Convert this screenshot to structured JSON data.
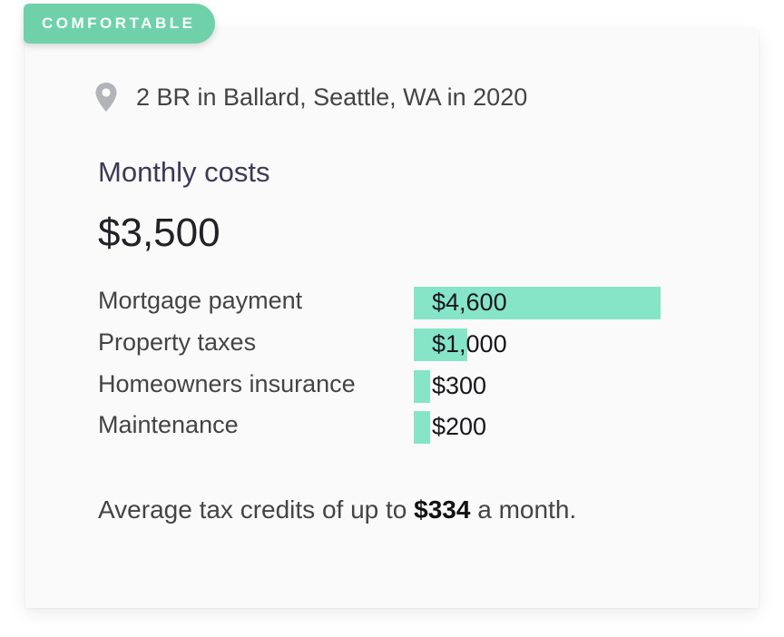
{
  "badge": {
    "label": "COMFORTABLE"
  },
  "location": {
    "icon": "map-pin-icon",
    "text": "2 BR in Ballard, Seattle, WA in 2020"
  },
  "monthly": {
    "title": "Monthly costs",
    "total": "$3,500"
  },
  "costs": [
    {
      "label": "Mortgage payment",
      "value": "$4,600",
      "amount": 4600
    },
    {
      "label": "Property taxes",
      "value": "$1,000",
      "amount": 1000
    },
    {
      "label": "Homeowners insurance",
      "value": "$300",
      "amount": 300
    },
    {
      "label": "Maintenance",
      "value": "$200",
      "amount": 200
    }
  ],
  "footer": {
    "prefix": "Average tax credits of up to ",
    "amount": "$334",
    "suffix": " a month."
  },
  "colors": {
    "accent": "#6fd1aa",
    "bar": "#86e5c7",
    "icon": "#b3b3ba"
  }
}
